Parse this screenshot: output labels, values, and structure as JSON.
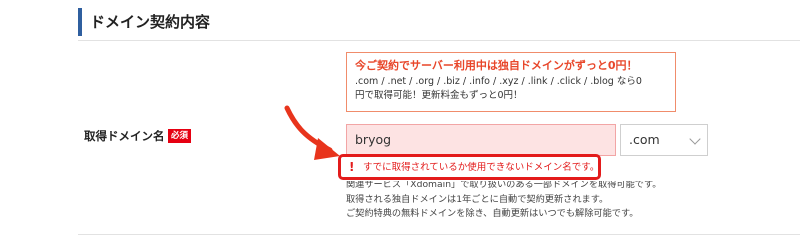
{
  "section": {
    "title": "ドメイン契約内容"
  },
  "promo": {
    "headline": "今ご契約でサーバー利用中は独自ドメインがずっと0円！",
    "body_line1": ".com / .net / .org / .biz / .info / .xyz / .link / .click / .blog なら0",
    "body_line2": "円で取得可能！更新料金もずっと0円！"
  },
  "field": {
    "label": "取得ドメイン名",
    "required_badge": "必須",
    "input_value": "bryog",
    "tld_value": ".com"
  },
  "error": {
    "icon": "!",
    "message": "すでに取得されているか使用できないドメイン名です。"
  },
  "notes": {
    "line1": "関連サービス「Xdomain」で取り扱いのある一部ドメインを取得可能です。",
    "line2": "取得される独自ドメインは1年ごとに自動で契約更新されます。",
    "line3": "ご契約特典の無料ドメインを除き、自動更新はいつでも解除可能です。"
  },
  "colors": {
    "accent_bar": "#2f5f9f",
    "error_red": "#e31b1b",
    "promo_border": "#f08c6b",
    "input_bg": "#fde3e3"
  },
  "icons": {
    "annotation_arrow": "red-curved-arrow-icon",
    "tld_chevron": "chevron-down-icon",
    "error": "exclamation-icon"
  }
}
